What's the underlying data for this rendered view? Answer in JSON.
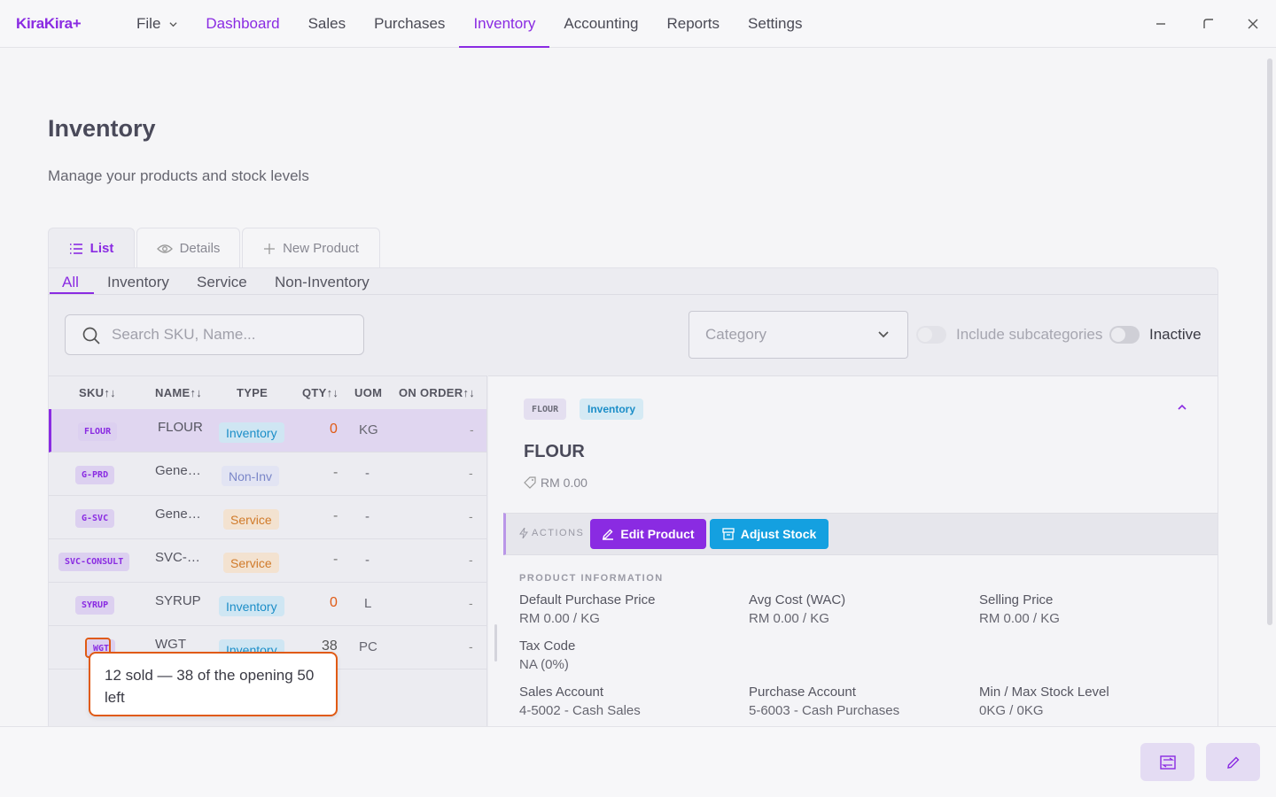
{
  "app": {
    "logo": "KiraKira+"
  },
  "menu": {
    "file": "File",
    "items": [
      "Dashboard",
      "Sales",
      "Purchases",
      "Inventory",
      "Accounting",
      "Reports",
      "Settings"
    ]
  },
  "page": {
    "title": "Inventory",
    "subtitle": "Manage your products and stock levels"
  },
  "view_tabs": {
    "list": "List",
    "details": "Details",
    "new_product": "New Product"
  },
  "filter_tabs": [
    "All",
    "Inventory",
    "Service",
    "Non-Inventory"
  ],
  "search": {
    "placeholder": "Search SKU, Name..."
  },
  "category": {
    "placeholder": "Category"
  },
  "toggles": {
    "include_subcategories": "Include subcategories",
    "inactive": "Inactive"
  },
  "table": {
    "headers": {
      "sku": "SKU",
      "name": "NAME",
      "type": "TYPE",
      "qty": "QTY",
      "uom": "UOM",
      "on_order": "ON ORDER"
    },
    "rows": [
      {
        "sku": "FLOUR",
        "name": "FLOUR",
        "type": "Inventory",
        "qty": "0",
        "uom": "KG",
        "on_order": "-"
      },
      {
        "sku": "G-PRD",
        "name": "Gene…",
        "type": "Non-Inv",
        "qty": "-",
        "uom": "-",
        "on_order": "-"
      },
      {
        "sku": "G-SVC",
        "name": "Gene…",
        "type": "Service",
        "qty": "-",
        "uom": "-",
        "on_order": "-"
      },
      {
        "sku": "SVC-CONSULT",
        "name": "SVC-…",
        "type": "Service",
        "qty": "-",
        "uom": "-",
        "on_order": "-"
      },
      {
        "sku": "SYRUP",
        "name": "SYRUP",
        "type": "Inventory",
        "qty": "0",
        "uom": "L",
        "on_order": "-"
      },
      {
        "sku": "WGT",
        "name": "WGT",
        "type": "Inventory",
        "qty": "38",
        "uom": "PC",
        "on_order": "-"
      }
    ]
  },
  "tooltip": {
    "text": "12 sold — 38 of the opening 50 left"
  },
  "detail": {
    "sku": "FLOUR",
    "type": "Inventory",
    "title": "FLOUR",
    "price": "RM 0.00",
    "actions_label": "ACTIONS",
    "edit_button": "Edit Product",
    "adjust_button": "Adjust Stock",
    "section_label": "PRODUCT INFORMATION",
    "fields": [
      {
        "label": "Default Purchase Price",
        "value": "RM 0.00 / KG"
      },
      {
        "label": "Avg Cost (WAC)",
        "value": "RM 0.00 / KG"
      },
      {
        "label": "Selling Price",
        "value": "RM 0.00 / KG"
      },
      {
        "label": "Tax Code",
        "value": "NA (0%)"
      },
      {
        "label": "Sales Account",
        "value": "4-5002 - Cash Sales"
      },
      {
        "label": "Purchase Account",
        "value": "5-6003 - Cash Purchases"
      },
      {
        "label": "Min / Max Stock Level",
        "value": "0KG / 0KG"
      }
    ]
  },
  "colors": {
    "accent": "#8a2be2",
    "info": "#14a0e0",
    "warning": "#e05a14"
  }
}
